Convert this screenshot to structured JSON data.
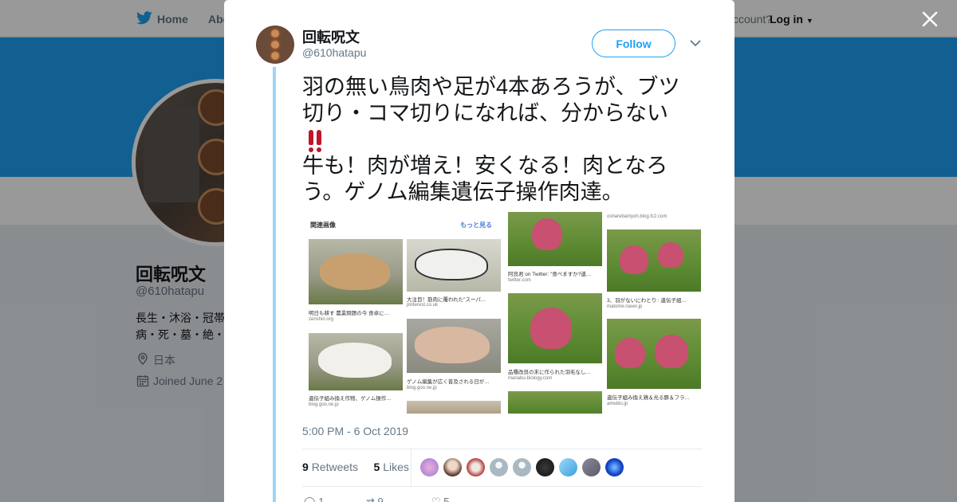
{
  "nav": {
    "home_label": "Home",
    "about_label": "Abo",
    "account_prompt": "ccount?",
    "login_label": "Log in"
  },
  "profile": {
    "name": "回転呪文",
    "handle": "@610hatapu",
    "bio_line1": "長生・沐浴・冠帯",
    "bio_line2": "病・死・墓・絶・",
    "location": "日本",
    "joined": "Joined June 2"
  },
  "tweet": {
    "author_name": "回転呪文",
    "author_handle": "@610hatapu",
    "follow_label": "Follow",
    "text_line1": "羽の無い鳥肉や足が4本あろうが、ブツ",
    "text_line2": "切り・コマ切りになれば、分からない",
    "text_line4": "牛も！肉が増え！安くなる！肉となろ",
    "text_line5": "う。ゲノム編集遺伝子操作肉達。",
    "emoji": "double-exclamation-icon",
    "timestamp": "5:00 PM - 6 Oct 2019",
    "retweets_count": "9",
    "retweets_label": "Retweets",
    "likes_count": "5",
    "likes_label": "Likes",
    "reply_count": "1",
    "retweet_action_count": "9",
    "like_action_count": "5"
  },
  "media": {
    "left_header": "関連画像",
    "left_more": "もっと見る",
    "captions": [
      {
        "cap": "明日も耕す 農業問題の今 食卓に…",
        "src": "zenshin.org"
      },
      {
        "cap": "大注目！筋肉に覆われた\"スーパ…",
        "src": "pinterest.co.uk"
      },
      {
        "cap": "遺伝子組み換え作物、ゲノム操作…",
        "src": "blog.goo.ne.jp"
      },
      {
        "cap": "ゲノム編集が広く普及される日が…",
        "src": "blog.goo.ne.jp"
      },
      {
        "cap": "阿良君 on Twitter: \"食べますか?遺…",
        "src": "twitter.com"
      },
      {
        "cap": "3、羽がないにわとり : 遺伝子組…",
        "src": "matome.naver.jp"
      },
      {
        "cap": "品種改良の末に作られた羽毛なし…",
        "src": "manabu-biology.com"
      },
      {
        "cap": "遺伝子組み換え鶏＆光る豚＆フラ…",
        "src": "ameblo.jp"
      }
    ],
    "top_source": "osharebantyoh.blog.fc2.com"
  },
  "colors": {
    "brand": "#1da1f2",
    "thread": "#9fd4f7",
    "emoji": "#c0162c"
  }
}
